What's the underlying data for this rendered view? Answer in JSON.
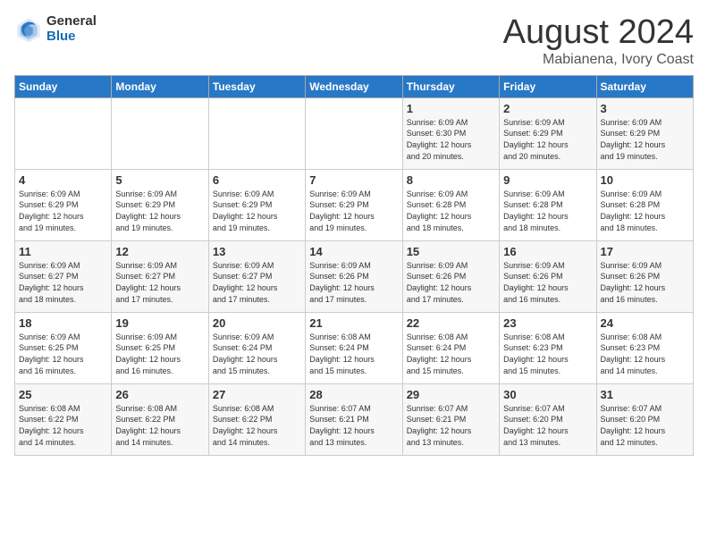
{
  "logo": {
    "general": "General",
    "blue": "Blue"
  },
  "title": {
    "month_year": "August 2024",
    "location": "Mabianena, Ivory Coast"
  },
  "weekdays": [
    "Sunday",
    "Monday",
    "Tuesday",
    "Wednesday",
    "Thursday",
    "Friday",
    "Saturday"
  ],
  "weeks": [
    [
      {
        "day": "",
        "info": ""
      },
      {
        "day": "",
        "info": ""
      },
      {
        "day": "",
        "info": ""
      },
      {
        "day": "",
        "info": ""
      },
      {
        "day": "1",
        "info": "Sunrise: 6:09 AM\nSunset: 6:30 PM\nDaylight: 12 hours\nand 20 minutes."
      },
      {
        "day": "2",
        "info": "Sunrise: 6:09 AM\nSunset: 6:29 PM\nDaylight: 12 hours\nand 20 minutes."
      },
      {
        "day": "3",
        "info": "Sunrise: 6:09 AM\nSunset: 6:29 PM\nDaylight: 12 hours\nand 19 minutes."
      }
    ],
    [
      {
        "day": "4",
        "info": "Sunrise: 6:09 AM\nSunset: 6:29 PM\nDaylight: 12 hours\nand 19 minutes."
      },
      {
        "day": "5",
        "info": "Sunrise: 6:09 AM\nSunset: 6:29 PM\nDaylight: 12 hours\nand 19 minutes."
      },
      {
        "day": "6",
        "info": "Sunrise: 6:09 AM\nSunset: 6:29 PM\nDaylight: 12 hours\nand 19 minutes."
      },
      {
        "day": "7",
        "info": "Sunrise: 6:09 AM\nSunset: 6:29 PM\nDaylight: 12 hours\nand 19 minutes."
      },
      {
        "day": "8",
        "info": "Sunrise: 6:09 AM\nSunset: 6:28 PM\nDaylight: 12 hours\nand 18 minutes."
      },
      {
        "day": "9",
        "info": "Sunrise: 6:09 AM\nSunset: 6:28 PM\nDaylight: 12 hours\nand 18 minutes."
      },
      {
        "day": "10",
        "info": "Sunrise: 6:09 AM\nSunset: 6:28 PM\nDaylight: 12 hours\nand 18 minutes."
      }
    ],
    [
      {
        "day": "11",
        "info": "Sunrise: 6:09 AM\nSunset: 6:27 PM\nDaylight: 12 hours\nand 18 minutes."
      },
      {
        "day": "12",
        "info": "Sunrise: 6:09 AM\nSunset: 6:27 PM\nDaylight: 12 hours\nand 17 minutes."
      },
      {
        "day": "13",
        "info": "Sunrise: 6:09 AM\nSunset: 6:27 PM\nDaylight: 12 hours\nand 17 minutes."
      },
      {
        "day": "14",
        "info": "Sunrise: 6:09 AM\nSunset: 6:26 PM\nDaylight: 12 hours\nand 17 minutes."
      },
      {
        "day": "15",
        "info": "Sunrise: 6:09 AM\nSunset: 6:26 PM\nDaylight: 12 hours\nand 17 minutes."
      },
      {
        "day": "16",
        "info": "Sunrise: 6:09 AM\nSunset: 6:26 PM\nDaylight: 12 hours\nand 16 minutes."
      },
      {
        "day": "17",
        "info": "Sunrise: 6:09 AM\nSunset: 6:26 PM\nDaylight: 12 hours\nand 16 minutes."
      }
    ],
    [
      {
        "day": "18",
        "info": "Sunrise: 6:09 AM\nSunset: 6:25 PM\nDaylight: 12 hours\nand 16 minutes."
      },
      {
        "day": "19",
        "info": "Sunrise: 6:09 AM\nSunset: 6:25 PM\nDaylight: 12 hours\nand 16 minutes."
      },
      {
        "day": "20",
        "info": "Sunrise: 6:09 AM\nSunset: 6:24 PM\nDaylight: 12 hours\nand 15 minutes."
      },
      {
        "day": "21",
        "info": "Sunrise: 6:08 AM\nSunset: 6:24 PM\nDaylight: 12 hours\nand 15 minutes."
      },
      {
        "day": "22",
        "info": "Sunrise: 6:08 AM\nSunset: 6:24 PM\nDaylight: 12 hours\nand 15 minutes."
      },
      {
        "day": "23",
        "info": "Sunrise: 6:08 AM\nSunset: 6:23 PM\nDaylight: 12 hours\nand 15 minutes."
      },
      {
        "day": "24",
        "info": "Sunrise: 6:08 AM\nSunset: 6:23 PM\nDaylight: 12 hours\nand 14 minutes."
      }
    ],
    [
      {
        "day": "25",
        "info": "Sunrise: 6:08 AM\nSunset: 6:22 PM\nDaylight: 12 hours\nand 14 minutes."
      },
      {
        "day": "26",
        "info": "Sunrise: 6:08 AM\nSunset: 6:22 PM\nDaylight: 12 hours\nand 14 minutes."
      },
      {
        "day": "27",
        "info": "Sunrise: 6:08 AM\nSunset: 6:22 PM\nDaylight: 12 hours\nand 14 minutes."
      },
      {
        "day": "28",
        "info": "Sunrise: 6:07 AM\nSunset: 6:21 PM\nDaylight: 12 hours\nand 13 minutes."
      },
      {
        "day": "29",
        "info": "Sunrise: 6:07 AM\nSunset: 6:21 PM\nDaylight: 12 hours\nand 13 minutes."
      },
      {
        "day": "30",
        "info": "Sunrise: 6:07 AM\nSunset: 6:20 PM\nDaylight: 12 hours\nand 13 minutes."
      },
      {
        "day": "31",
        "info": "Sunrise: 6:07 AM\nSunset: 6:20 PM\nDaylight: 12 hours\nand 12 minutes."
      }
    ]
  ]
}
